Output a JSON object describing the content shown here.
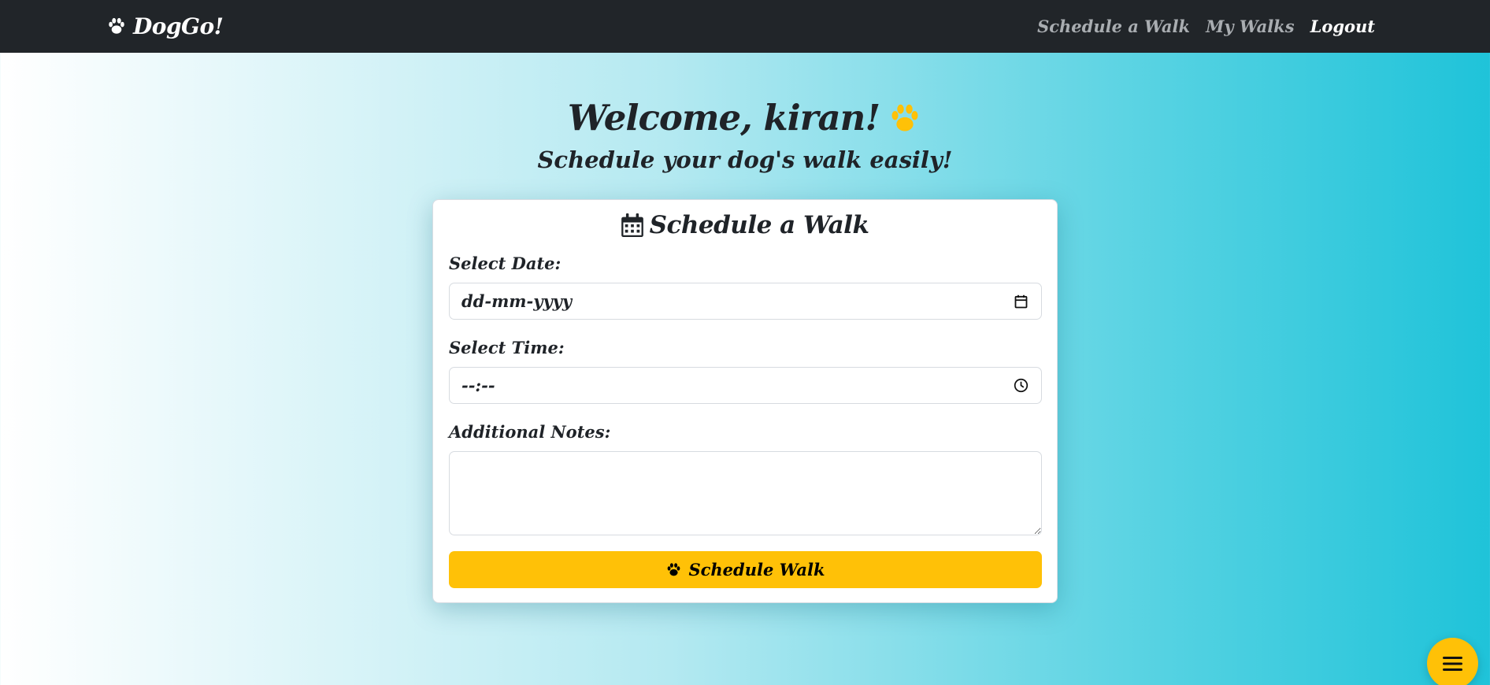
{
  "header": {
    "brand": "DogGo!",
    "brand_icon": "paw-icon",
    "nav": [
      {
        "label": "Schedule a Walk",
        "active": false
      },
      {
        "label": "My Walks",
        "active": false
      },
      {
        "label": "Logout",
        "active": true
      }
    ]
  },
  "welcome": {
    "title": "Welcome, kiran!",
    "title_icon": "paw-icon",
    "subtitle": "Schedule your dog's walk easily!"
  },
  "form": {
    "title": "Schedule a Walk",
    "title_icon": "calendar-icon",
    "date": {
      "label": "Select Date:",
      "value": "dd-mm-yyyy",
      "icon": "calendar-icon"
    },
    "time": {
      "label": "Select Time:",
      "value": "--:--",
      "icon": "clock-icon"
    },
    "notes": {
      "label": "Additional Notes:",
      "value": ""
    },
    "submit": {
      "label": "Schedule Walk",
      "icon": "paw-icon"
    }
  },
  "fab": {
    "icon": "menu-icon"
  },
  "colors": {
    "navbar": "#212529",
    "accent": "#ffc107",
    "text": "#1f2328",
    "nav_muted": "#a9adb1",
    "gradient_start": "#ffffff",
    "gradient_end": "#1fc3d9"
  }
}
